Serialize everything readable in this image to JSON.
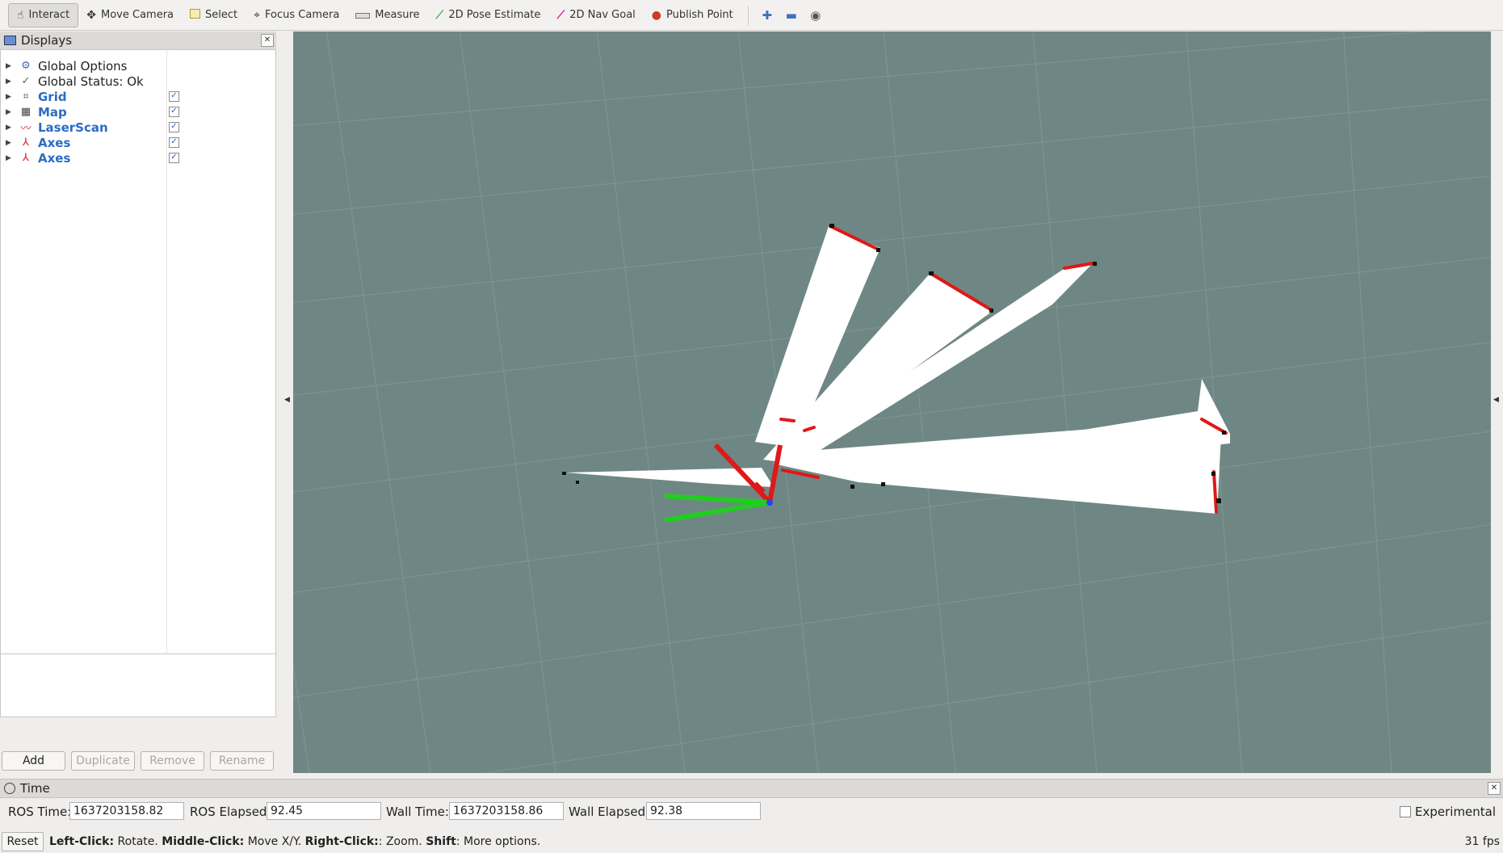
{
  "toolbar": {
    "interact": "Interact",
    "move_camera": "Move Camera",
    "select": "Select",
    "focus_camera": "Focus Camera",
    "measure": "Measure",
    "pose_estimate": "2D Pose Estimate",
    "nav_goal": "2D Nav Goal",
    "publish_point": "Publish Point"
  },
  "displays": {
    "title": "Displays",
    "items": [
      {
        "label": "Global Options",
        "icon": "gear-icon",
        "checkable": false
      },
      {
        "label": "Global Status: Ok",
        "icon": "check-icon",
        "checkable": false
      },
      {
        "label": "Grid",
        "icon": "grid-icon",
        "checkable": true,
        "checked": true
      },
      {
        "label": "Map",
        "icon": "map-icon",
        "checkable": true,
        "checked": true
      },
      {
        "label": "LaserScan",
        "icon": "laserscan-icon",
        "checkable": true,
        "checked": true
      },
      {
        "label": "Axes",
        "icon": "axes-icon",
        "checkable": true,
        "checked": true
      },
      {
        "label": "Axes",
        "icon": "axes-icon",
        "checkable": true,
        "checked": true
      }
    ],
    "buttons": {
      "add": "Add",
      "duplicate": "Duplicate",
      "remove": "Remove",
      "rename": "Rename"
    }
  },
  "time": {
    "title": "Time",
    "ros_time_label": "ROS Time:",
    "ros_time": "1637203158.82",
    "ros_elapsed_label": "ROS Elapsed:",
    "ros_elapsed": "92.45",
    "wall_time_label": "Wall Time:",
    "wall_time": "1637203158.86",
    "wall_elapsed_label": "Wall Elapsed:",
    "wall_elapsed": "92.38",
    "experimental": "Experimental"
  },
  "status": {
    "reset": "Reset",
    "left_click": "Left-Click:",
    "left_desc": " Rotate. ",
    "middle_click": "Middle-Click:",
    "middle_desc": " Move X/Y. ",
    "right_click": "Right-Click:",
    "right_desc": ": Zoom. ",
    "shift": "Shift",
    "shift_desc": ": More options.",
    "fps": "31 fps"
  },
  "colors": {
    "viewport_bg": "#6f8784",
    "free_space": "#ffffff",
    "laser": "#e01818",
    "axis_x": "#e01818",
    "axis_y": "#22cc22",
    "axis_z": "#2244ff"
  }
}
